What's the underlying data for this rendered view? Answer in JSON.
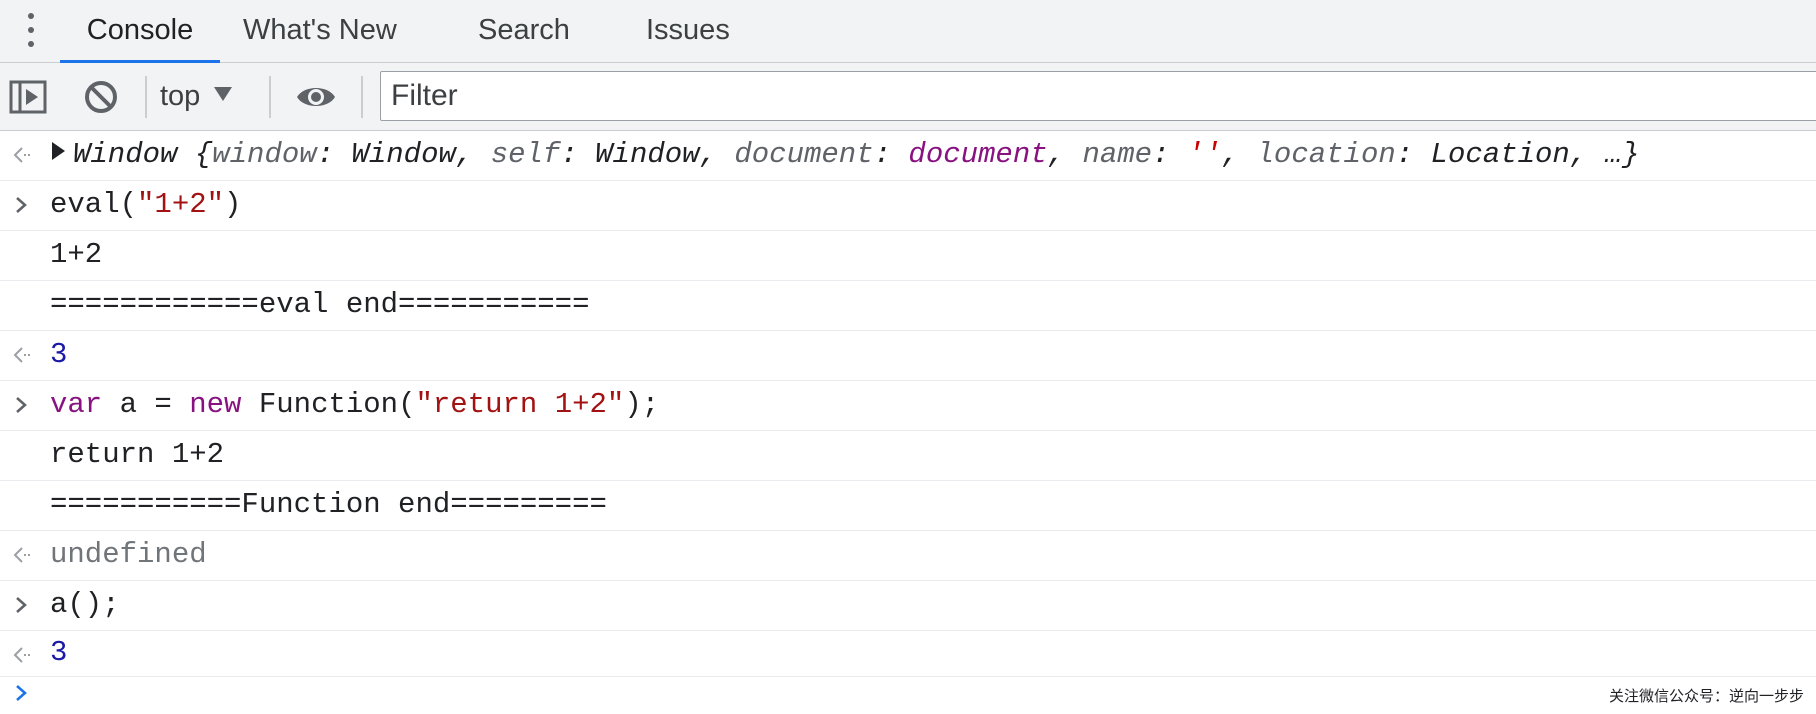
{
  "tabs": {
    "menu_icon": "more-vertical-icon",
    "items": [
      {
        "label": "Console",
        "active": true
      },
      {
        "label": "What's New",
        "active": false
      },
      {
        "label": "Search",
        "active": false
      },
      {
        "label": "Issues",
        "active": false
      }
    ]
  },
  "toolbar": {
    "sidebar_icon": "show-sidebar-icon",
    "clear_icon": "clear-console-icon",
    "context": "top",
    "eye_icon": "live-expression-icon",
    "filter_placeholder": "Filter",
    "filter_value": ""
  },
  "console": {
    "window_obj": {
      "name": "Window",
      "open": "{",
      "k_window": "window",
      "v_window": "Window",
      "k_self": "self",
      "v_self": "Window",
      "k_document": "document",
      "v_document": "document",
      "k_name": "name",
      "v_name": "''",
      "k_location": "location",
      "v_location": "Location",
      "tail": "…}"
    },
    "line2": {
      "fn": "eval(",
      "arg": "\"1+2\"",
      "close": ")"
    },
    "line3": "1+2",
    "line4": "============eval end===========",
    "line5": "3",
    "line6": {
      "kw_var": "var",
      "mid": " a = ",
      "kw_new": "new",
      "fn": " Function(",
      "arg": "\"return 1+2\"",
      "close": ");"
    },
    "line7": "return 1+2",
    "line8": "===========Function end=========",
    "line9": "undefined",
    "line10": "a();",
    "line11": "3"
  },
  "watermark": "关注微信公众号：逆向一步步",
  "colors": {
    "accent": "#1a73e8",
    "keyword": "#881280",
    "string": "#c80000",
    "number": "#1a1aa6"
  }
}
